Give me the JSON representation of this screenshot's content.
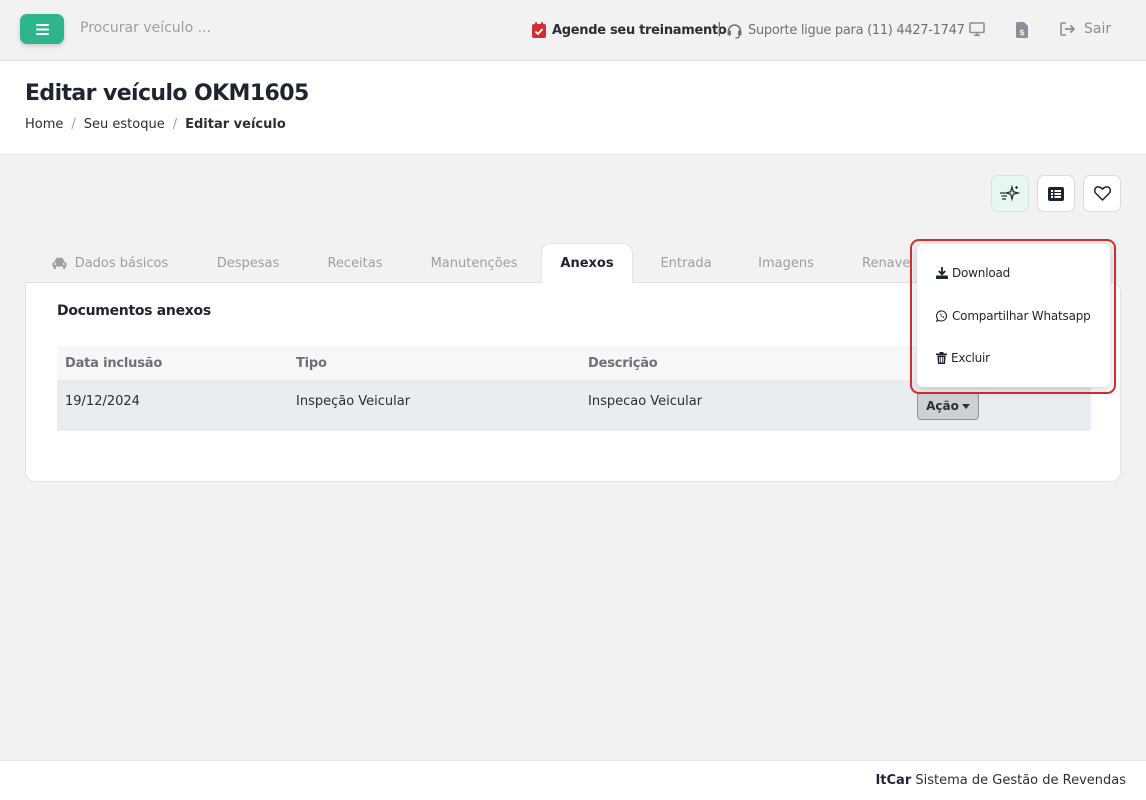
{
  "topbar": {
    "search_placeholder": "Procurar veículo ...",
    "training_label": "Agende seu treinamento",
    "separator": "|",
    "support_label": "Suporte ligue para (11) 4427-1747",
    "logout_label": "Sair",
    "icons": [
      "hamburger-menu-icon",
      "calendar-check-icon",
      "headset-icon",
      "monitor-icon",
      "document-dollar-icon",
      "logout-icon"
    ]
  },
  "header": {
    "title": "Editar veículo OKM1605",
    "breadcrumb": [
      "Home",
      "Seu estoque",
      "Editar veículo"
    ],
    "breadcrumb_separator": "/"
  },
  "actions": {
    "icons": [
      "sparkle-ai-icon",
      "list-icon",
      "heart-icon"
    ]
  },
  "tabs": [
    {
      "label": "Dados básicos",
      "icon": "car-icon"
    },
    {
      "label": "Despesas"
    },
    {
      "label": "Receitas"
    },
    {
      "label": "Manutenções"
    },
    {
      "label": "Anexos",
      "active": true
    },
    {
      "label": "Entrada"
    },
    {
      "label": "Imagens"
    },
    {
      "label": "Renave"
    }
  ],
  "attachments": {
    "title": "Documentos anexos",
    "columns": [
      "Data inclusão",
      "Tipo",
      "Descrição"
    ],
    "rows": [
      {
        "date": "19/12/2024",
        "type": "Inspeção Veicular",
        "description": "Inspecao Veicular",
        "action_label": "Ação"
      }
    ]
  },
  "dropdown": {
    "items": [
      {
        "label": "Download",
        "icon": "download-icon"
      },
      {
        "label": "Compartilhar Whatsapp",
        "icon": "whatsapp-icon"
      },
      {
        "label": "Excluir",
        "icon": "trash-icon"
      }
    ]
  },
  "footer": {
    "brand": "ItCar",
    "text": "Sistema de Gestão de Revendas"
  },
  "colors": {
    "accent": "#2fb58e",
    "highlight": "#d32f2f",
    "calendar": "#d32f2f"
  }
}
